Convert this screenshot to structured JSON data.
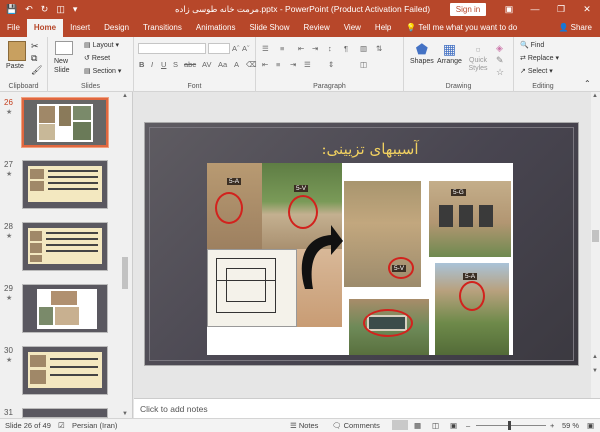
{
  "window": {
    "title": "مرمت خانه طوسی زاده.pptx - PowerPoint (Product Activation Failed)",
    "sign_in": "Sign in"
  },
  "tabs": [
    "File",
    "Home",
    "Insert",
    "Design",
    "Transitions",
    "Animations",
    "Slide Show",
    "Review",
    "View",
    "Help"
  ],
  "tell_me": "Tell me what you want to do",
  "share": "Share",
  "ribbon": {
    "clipboard": {
      "label": "Clipboard",
      "paste": "Paste"
    },
    "slides": {
      "label": "Slides",
      "new_slide": "New Slide",
      "layout": "Layout",
      "reset": "Reset",
      "section": "Section"
    },
    "font": {
      "label": "Font"
    },
    "paragraph": {
      "label": "Paragraph"
    },
    "drawing": {
      "label": "Drawing",
      "shapes": "Shapes",
      "arrange": "Arrange",
      "quick_styles": "Quick Styles"
    },
    "editing": {
      "label": "Editing",
      "find": "Find",
      "replace": "Replace",
      "select": "Select"
    }
  },
  "thumbnails": [
    {
      "num": "26",
      "selected": true
    },
    {
      "num": "27",
      "selected": false
    },
    {
      "num": "28",
      "selected": false
    },
    {
      "num": "29",
      "selected": false
    },
    {
      "num": "30",
      "selected": false
    },
    {
      "num": "31",
      "selected": false
    }
  ],
  "slide": {
    "title": "آسیبهای تزیینی:",
    "labels": [
      "5-A",
      "5-V",
      "5-V",
      "5-G",
      "5-A"
    ]
  },
  "notes_placeholder": "Click to add notes",
  "status": {
    "slide_info": "Slide 26 of 49",
    "language": "Persian (Iran)",
    "notes": "Notes",
    "comments": "Comments",
    "zoom": "59 %"
  },
  "colors": {
    "accent": "#b7472a",
    "title_text": "#f0d060",
    "highlight": "#d2221d"
  }
}
